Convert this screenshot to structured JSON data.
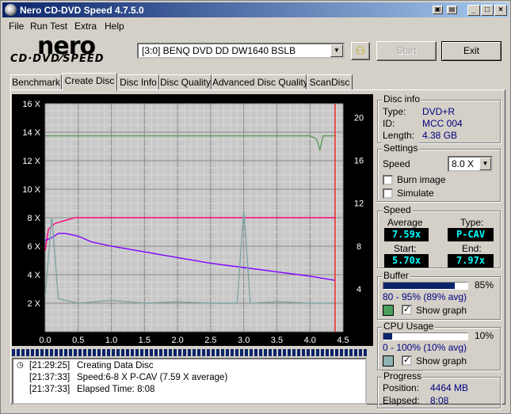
{
  "window": {
    "title": "Nero CD-DVD Speed 4.7.5.0"
  },
  "menu": [
    "File",
    "Run Test",
    "Extra",
    "Help"
  ],
  "logo": {
    "nero": "nero",
    "cdvd": "CD·DVD⁄SPEED"
  },
  "toolbar": {
    "drive": "[3:0]   BENQ DVD DD DW1640 BSLB",
    "start_label": "Start",
    "exit_label": "Exit"
  },
  "tabs": [
    "Benchmark",
    "Create Disc",
    "Disc Info",
    "Disc Quality",
    "Advanced Disc Quality",
    "ScanDisc"
  ],
  "active_tab": 1,
  "disc_info": {
    "title": "Disc info",
    "type_label": "Type:",
    "type": "DVD+R",
    "id_label": "ID:",
    "id": "MCC 004",
    "length_label": "Length:",
    "length": "4.38 GB"
  },
  "settings": {
    "title": "Settings",
    "speed_label": "Speed",
    "speed_value": "8.0 X",
    "burn_image_label": "Burn image",
    "simulate_label": "Simulate"
  },
  "speed": {
    "title": "Speed",
    "average_label": "Average",
    "average": "7.59x",
    "type_label": "Type:",
    "type": "P-CAV",
    "start_label": "Start:",
    "start": "5.70x",
    "end_label": "End:",
    "end": "7.97x"
  },
  "buffer": {
    "title": "Buffer",
    "level": 0.85,
    "percent": "85%",
    "range": "80 - 95% (89% avg)",
    "show_graph_label": "Show graph",
    "color": "#4a9e5c"
  },
  "cpu": {
    "title": "CPU Usage",
    "level": 0.1,
    "percent": "10%",
    "range": "0 - 100% (10% avg)",
    "show_graph_label": "Show graph",
    "color": "#8fb3b3"
  },
  "progress": {
    "title": "Progress",
    "position_label": "Position:",
    "position": "4464 MB",
    "elapsed_label": "Elapsed:",
    "elapsed": "8:08"
  },
  "log": [
    {
      "time": "[21:29:25]",
      "msg": "Creating Data Disc"
    },
    {
      "time": "[21:37:33]",
      "msg": "Speed:6-8 X P-CAV (7.59 X average)"
    },
    {
      "time": "[21:37:33]",
      "msg": "Elapsed Time:  8:08"
    }
  ],
  "chart_data": {
    "type": "line",
    "x_ticks": [
      "0.0",
      "0.5",
      "1.0",
      "1.5",
      "2.0",
      "2.5",
      "3.0",
      "3.5",
      "4.0",
      "4.5"
    ],
    "y_left_ticks": [
      "2 X",
      "4 X",
      "6 X",
      "8 X",
      "10 X",
      "12 X",
      "14 X",
      "16 X"
    ],
    "y_right_ticks": [
      "4",
      "8",
      "12",
      "16",
      "20"
    ],
    "xlim": [
      0,
      4.5
    ],
    "ylim_left": [
      0,
      16
    ],
    "ylim_right": [
      0,
      21.3
    ],
    "end_marker_x": 4.38,
    "series": [
      {
        "color": "#ff0080",
        "x": [
          0.0,
          0.05,
          0.15,
          0.3,
          0.45,
          0.6,
          0.8,
          1.0,
          1.5,
          2.0,
          2.5,
          3.0,
          3.5,
          4.0,
          4.38
        ],
        "y": [
          5.7,
          7.2,
          7.6,
          7.8,
          8.0,
          8.0,
          8.0,
          8.0,
          8.0,
          8.0,
          8.0,
          8.0,
          8.0,
          8.0,
          8.0
        ]
      },
      {
        "color": "#8000ff",
        "x": [
          0.0,
          0.1,
          0.2,
          0.3,
          0.4,
          0.5,
          0.7,
          1.0,
          1.5,
          2.0,
          2.5,
          3.0,
          3.5,
          4.0,
          4.38
        ],
        "y": [
          6.4,
          6.6,
          6.9,
          6.9,
          6.8,
          6.7,
          6.3,
          6.0,
          5.6,
          5.2,
          4.8,
          4.5,
          4.2,
          3.9,
          3.6
        ]
      },
      {
        "color": "#5c9c58",
        "x": [
          0.0,
          1.0,
          2.0,
          3.0,
          4.0,
          4.1,
          4.15,
          4.2,
          4.38
        ],
        "y": [
          18.3,
          18.3,
          18.3,
          18.3,
          18.3,
          18.0,
          17.0,
          18.3,
          18.3
        ]
      },
      {
        "color": "#7fa4a4",
        "x": [
          0.0,
          0.1,
          0.2,
          0.5,
          1.0,
          1.5,
          2.0,
          2.5,
          2.9,
          3.0,
          3.1,
          3.5,
          4.0,
          4.38
        ],
        "y": [
          2.5,
          8.0,
          2.3,
          2.0,
          2.2,
          2.0,
          2.1,
          2.0,
          2.0,
          8.5,
          2.0,
          2.1,
          2.0,
          2.0
        ]
      }
    ]
  }
}
